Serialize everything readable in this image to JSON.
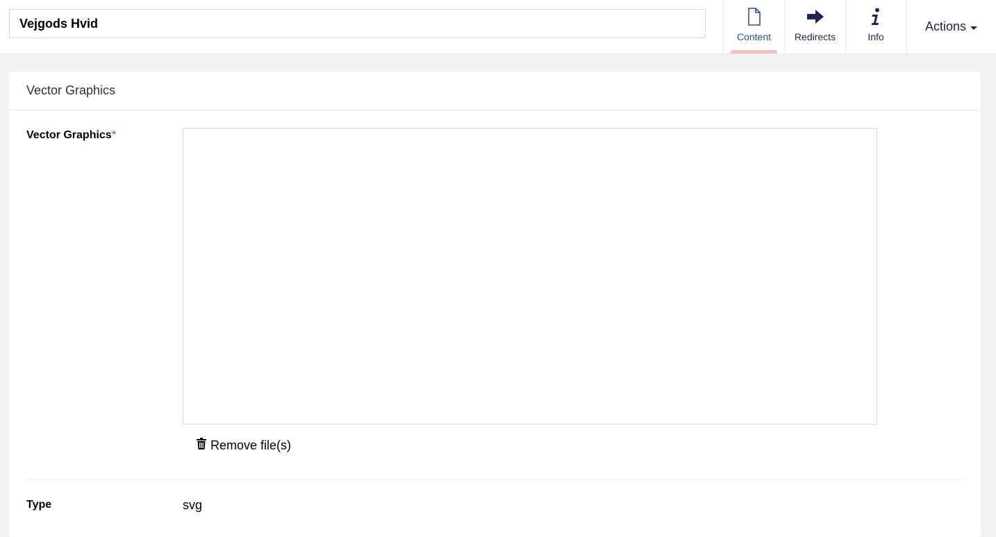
{
  "header": {
    "name_value": "Vejgods Hvid",
    "tabs": [
      {
        "label": "Content",
        "icon": "document-icon",
        "active": true
      },
      {
        "label": "Redirects",
        "icon": "arrow-right-icon",
        "active": false
      },
      {
        "label": "Info",
        "icon": "info-icon",
        "active": false
      }
    ],
    "actions_label": "Actions"
  },
  "panel": {
    "title": "Vector Graphics",
    "property": {
      "label": "Vector Graphics",
      "required_marker": "*",
      "remove_label": "Remove file(s)"
    },
    "type": {
      "label": "Type",
      "value": "svg"
    }
  },
  "colors": {
    "accent": "#2152a3",
    "active_indicator": "#f5c1bc",
    "required": "#d42054",
    "text_dark": "#1b264f"
  }
}
